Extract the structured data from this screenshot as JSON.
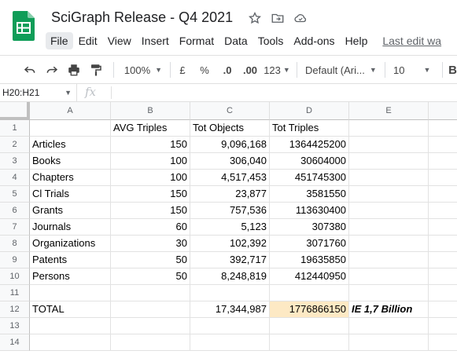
{
  "app": {
    "title": "SciGraph Release - Q4 2021",
    "logo_icon": "sheets-logo-icon"
  },
  "menu": {
    "items": [
      "File",
      "Edit",
      "View",
      "Insert",
      "Format",
      "Data",
      "Tools",
      "Add-ons",
      "Help"
    ],
    "last_edit": "Last edit wa"
  },
  "toolbar": {
    "zoom": "100%",
    "currency": "£",
    "percent": "%",
    "decrease_decimal": ".0",
    "increase_decimal": ".00",
    "number_format": "123",
    "font": "Default (Ari...",
    "font_size": "10"
  },
  "formula_bar": {
    "name_box": "H20:H21",
    "fx": "fx"
  },
  "grid": {
    "columns": [
      "A",
      "B",
      "C",
      "D",
      "E"
    ],
    "rows": [
      "1",
      "2",
      "3",
      "4",
      "5",
      "6",
      "7",
      "8",
      "9",
      "10",
      "11",
      "12",
      "13",
      "14"
    ],
    "cells": [
      [
        "",
        "AVG Triples",
        "Tot Objects",
        "Tot Triples",
        ""
      ],
      [
        "Articles",
        "150",
        "9,096,168",
        "1364425200",
        ""
      ],
      [
        "Books",
        "100",
        "306,040",
        "30604000",
        ""
      ],
      [
        "Chapters",
        "100",
        "4,517,453",
        "451745300",
        ""
      ],
      [
        "Cl Trials",
        "150",
        "23,877",
        "3581550",
        ""
      ],
      [
        "Grants",
        "150",
        "757,536",
        "113630400",
        ""
      ],
      [
        "Journals",
        "60",
        "5,123",
        "307380",
        ""
      ],
      [
        "Organizations",
        "30",
        "102,392",
        "3071760",
        ""
      ],
      [
        "Patents",
        "50",
        "392,717",
        "19635850",
        ""
      ],
      [
        "Persons",
        "50",
        "8,248,819",
        "412440950",
        ""
      ],
      [
        "",
        "",
        "",
        "",
        ""
      ],
      [
        "TOTAL",
        "",
        "17,344,987",
        "1776866150",
        "IE 1,7 Billion"
      ],
      [
        "",
        "",
        "",
        "",
        ""
      ],
      [
        "",
        "",
        "",
        "",
        ""
      ]
    ]
  },
  "colors": {
    "highlight": "#fde9c4",
    "selection": "#1a73e8",
    "logo": "#0f9d58"
  }
}
